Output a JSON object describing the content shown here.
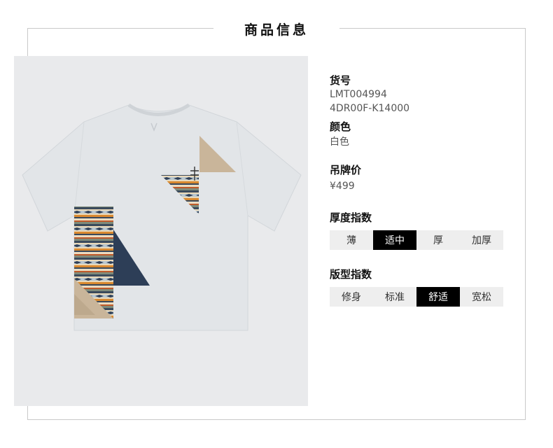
{
  "header": {
    "title": "商品信息"
  },
  "product": {
    "sku_label": "货号",
    "sku_values": [
      "LMT004994",
      "4DR00F-K14000"
    ],
    "color_label": "颜色",
    "color_value": "白色",
    "price_label": "吊牌价",
    "price_value": "¥499"
  },
  "thickness": {
    "label": "厚度指数",
    "options": [
      "薄",
      "适中",
      "厚",
      "加厚"
    ],
    "selected": "适中"
  },
  "fit": {
    "label": "版型指数",
    "options": [
      "修身",
      "标准",
      "舒适",
      "宽松"
    ],
    "selected": "舒适"
  },
  "colors": {
    "frame": "#c9c9c9",
    "photo_bg": "#e9eaec",
    "active_bg": "#000000",
    "option_bg": "#eeeeee"
  }
}
